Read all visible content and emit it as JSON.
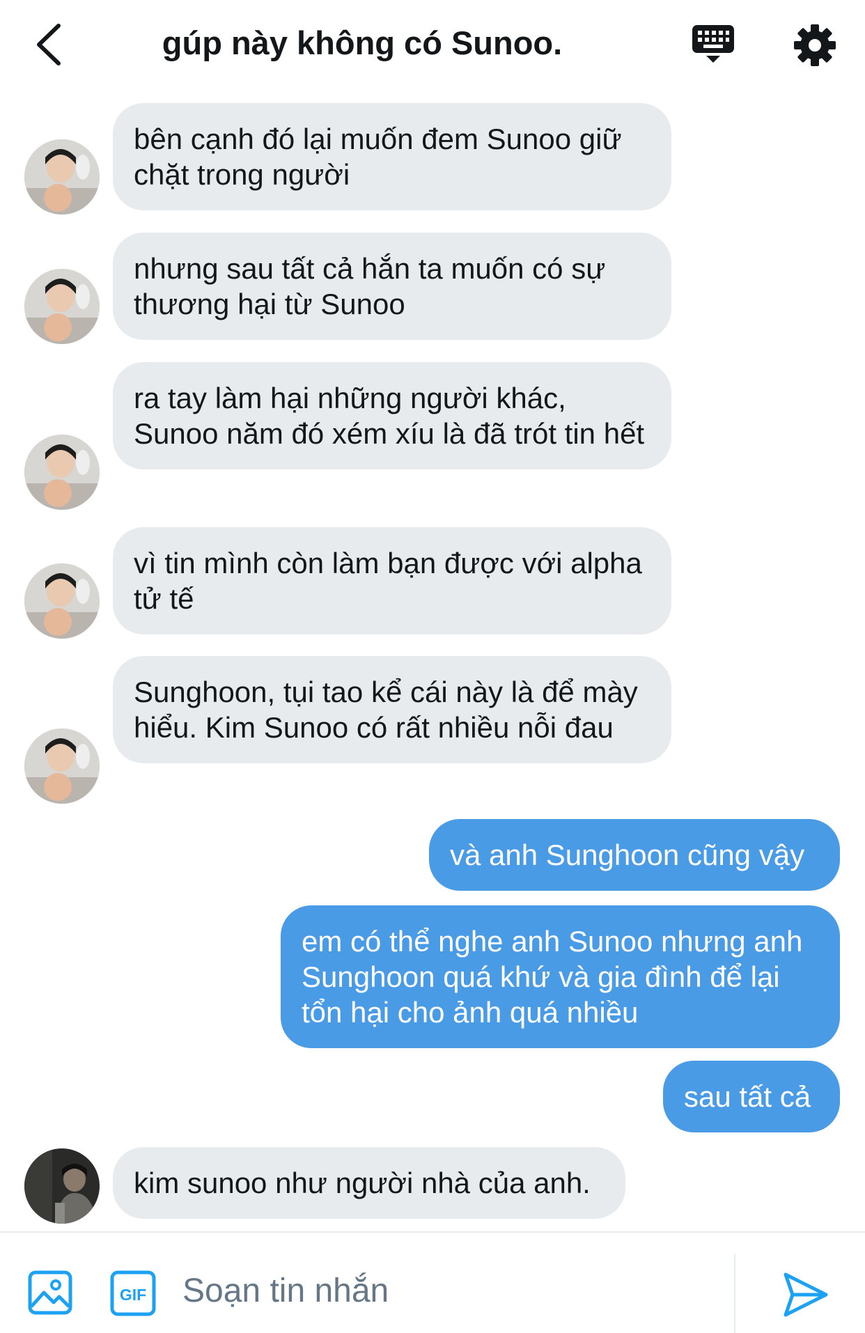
{
  "header": {
    "title": "gúp này không có Sunoo.",
    "icons": {
      "back": "chevron-left-icon",
      "keyboard": "keyboard-icon",
      "settings": "gear-icon"
    }
  },
  "messages": [
    {
      "direction": "in",
      "avatar": "avatar-photo",
      "text": "bên cạnh đó lại muốn đem Sunoo giữ chặt trong người"
    },
    {
      "direction": "in",
      "avatar": "avatar-photo",
      "text": "nhưng sau tất cả hắn ta muốn có sự thương hại từ Sunoo"
    },
    {
      "direction": "in",
      "avatar": "avatar-photo",
      "text": "ra tay làm hại những người khác, Sunoo năm đó xém xíu là đã trót tin hết"
    },
    {
      "direction": "in",
      "avatar": "avatar-photo",
      "text": "vì tin mình còn làm bạn được với alpha tử tế"
    },
    {
      "direction": "in",
      "avatar": "avatar-photo",
      "text": "Sunghoon, tụi tao kể cái này là để mày hiểu. Kim Sunoo có rất nhiều nỗi đau"
    },
    {
      "direction": "out",
      "text": "và anh Sunghoon cũng vậy"
    },
    {
      "direction": "out",
      "text": "em có thể nghe anh Sunoo nhưng anh Sunghoon quá khứ và gia đình để lại tổn hại cho ảnh quá nhiều"
    },
    {
      "direction": "out",
      "text": "sau tất cả"
    },
    {
      "direction": "in",
      "avatar": "avatar-photo-dark",
      "text": "kim sunoo như người nhà của anh."
    }
  ],
  "composer": {
    "placeholder": "Soạn tin nhắn",
    "value": "",
    "gif_label": "GIF",
    "icons": {
      "media": "image-icon",
      "gif": "gif-icon",
      "send": "send-icon"
    }
  },
  "colors": {
    "incoming_bubble": "#e8ebee",
    "outgoing_bubble": "#4a9be6",
    "accent": "#1da1f2",
    "placeholder": "#657786"
  }
}
